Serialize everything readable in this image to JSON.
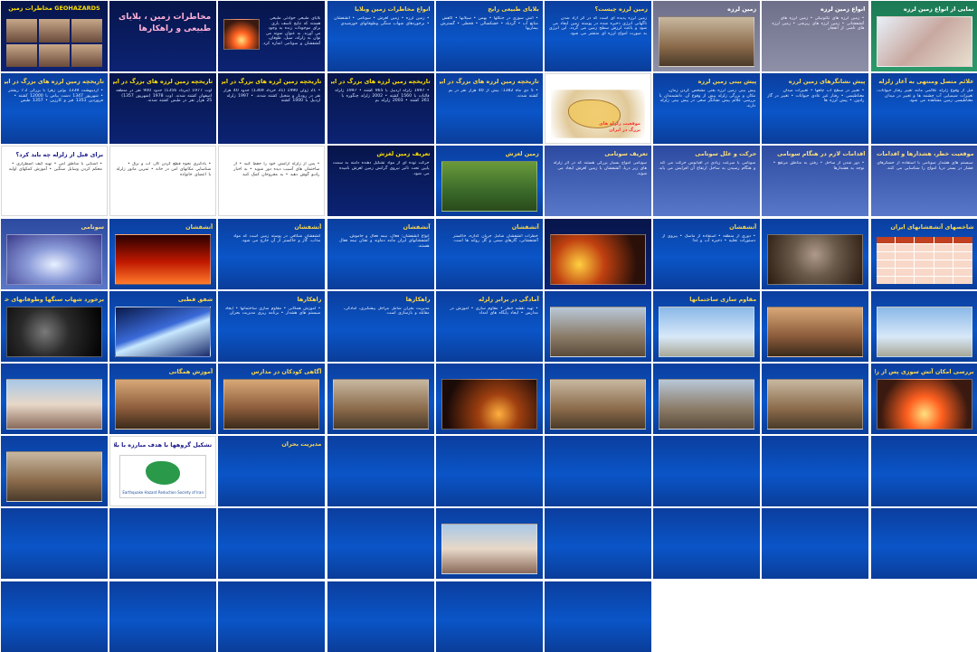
{
  "slides": [
    {
      "title": "مخاطرات زمین GEOHAZARDS",
      "body": "",
      "theme": "navy",
      "pic": "cover"
    },
    {
      "title": "",
      "body": "مخاطرات زمین ، بلایای طبیعی و راهکارها",
      "theme": "navy",
      "pic": "bigtitle"
    },
    {
      "title": "",
      "body": "بلایای طبیعی حوادثی طبیعی هستند که نتایج تاسف باری برای موجودات زنده به وجود می آورند. به عنوان نمونه می توان به زلزله، سیل، طوفان، آتشفشان و سونامی اشاره کرد.",
      "theme": "navy",
      "pic": "fire-small"
    },
    {
      "title": "انواع مخاطرات زمین وبلایا",
      "body": "• زمین لرزه  • زمین لغزش  • سونامی  • آتشفشان  • برخوردهای شهاب سنگی وطوفانهای خورشیدی",
      "theme": "blue",
      "pic": ""
    },
    {
      "title": "بلایای طبیعی رایج",
      "body": "• آتش سوزی در جنگلها  • بهمن  • سیلابها  • کاهش منابع آب  • گردباد  • خشکسالی  • قحطی  • گسترش بیماریها",
      "theme": "blue",
      "pic": ""
    },
    {
      "title": "زمین لرزه چیست؟",
      "body": "زمین لرزه پدیده ای است که در اثر آزاد شدن ناگهانی انرژی ذخیره شده در پوسته زمین ایجاد می شود و باعث لرزش سطح زمین می گردد. این انرژی به صورت امواج لرزه ای منتشر می شود.",
      "theme": "blue",
      "pic": ""
    },
    {
      "title": "زمین لرزه",
      "body": "",
      "theme": "gray",
      "pic": "rubble"
    },
    {
      "title": "انواع زمین لرزه",
      "body": "• زمین لرزه های تکتونیکی  • زمین لرزه های آتشفشانی  • زمین لرزه های ریزشی  • زمین لرزه های ناشی از انفجار",
      "theme": "gray",
      "pic": ""
    },
    {
      "title": "نمایی از انواع زمین لرزه",
      "body": "",
      "theme": "green",
      "pic": "fault"
    },
    {
      "title": "تاریخچه زمین لرزه های بزرگ در ایران",
      "body": "• اردیبهشت 1339 بوئین زهرا با بزرگی 7.2 ریشتر  • شهریور 1347 دشت بیاض با 12000 کشته  • فروردین 1351 قیر و کارزین  • 1357 طبس",
      "theme": "blue",
      "pic": ""
    },
    {
      "title": "تاریخچه زمین لرزه های بزرگ در ایران",
      "body": "اوت 1977 (مرداد 1356) حدود 900 نفر در منطقه اصفهان کشته شدند. اوت 1978 (شهریور 1357) 25 هزار نفر در طبس کشته شدند.",
      "theme": "navy",
      "pic": ""
    },
    {
      "title": "تاریخچه زمین لرزه های بزرگ در ایران",
      "body": "• 21 ژوئن 1990 (31 خرداد 1369) حدود 40 هزار نفر در رودبار و منجیل کشته شدند. • 1997 زلزله اردبیل با 1000 کشته",
      "theme": "navy",
      "pic": ""
    },
    {
      "title": "تاریخچه زمین لرزه های بزرگ در ایران",
      "body": "• 1997 زلزله اردبیل با 965 کشته  • 1997 زلزله قائنات با 1560 کشته  • 2002 زلزله چنگوره با 261 کشته  • 2003 زلزله بم",
      "theme": "navy",
      "pic": ""
    },
    {
      "title": "تاریخچه زمین لرزه های بزرگ در ایران",
      "body": "• 5 دی ماه 1382: بیش از 40 هزار نفر در بم کشته شدند.",
      "theme": "blue",
      "pic": ""
    },
    {
      "title": "",
      "body": "",
      "theme": "white",
      "pic": "map"
    },
    {
      "title": "پیش بینی زمین لرزه",
      "body": "پیش بینی زمین لرزه یعنی مشخص کردن زمان، مکان و بزرگی زلزله پیش از وقوع آن. دانشمندان با بررسی علائم پیش نشانگر سعی در پیش بینی زلزله دارند.",
      "theme": "blue",
      "pic": ""
    },
    {
      "title": "پیش نشانگرهای زمین لرزه",
      "body": "• تغییر در سطح آب چاهها  • تغییرات میدان مغناطیسی  • رفتار غیر عادی حیوانات  • تغییر در گاز رادون  • پیش لرزه ها",
      "theme": "blue",
      "pic": ""
    },
    {
      "title": "علائم متصل ومنتهی به آغاز زلزله",
      "body": "قبل از وقوع زلزله علائمی مانند تغییر رفتار حیوانات، تغییرات شیمیایی آب چشمه ها و تغییر در میدان مغناطیسی زمین مشاهده می شود.",
      "theme": "blue",
      "pic": ""
    },
    {
      "title": "برای قبل از زلزله چه باید کرد؟",
      "body": "• آشنایی با مناطق امن  • تهیه کیف اضطراری  • محکم کردن وسایل سنگین  • آموزش کمکهای اولیه",
      "theme": "white",
      "pic": ""
    },
    {
      "title": "",
      "body": "• یادگیری نحوه قطع کردن گاز، آب و برق  • شناسایی مکانهای امن در خانه  • تمرین مانور زلزله با اعضای خانواده",
      "theme": "white",
      "pic": ""
    },
    {
      "title": "",
      "body": "• پس از زلزله آرامش خود را حفظ کنید  • از ساختمان های آسیب دیده دور شوید  • به اخبار رادیو گوش دهید  • به مجروحان کمک کنید",
      "theme": "white",
      "pic": ""
    },
    {
      "title": "تعریف زمین لغزش",
      "body": "حرکت توده ای از مواد تشکیل دهنده دامنه به سمت پایین تحت تاثیر نیروی گرانش زمین لغزش نامیده می شود.",
      "theme": "navy",
      "pic": ""
    },
    {
      "title": "زمین لغزش",
      "body": "",
      "theme": "blue",
      "pic": "landslide"
    },
    {
      "title": "تعریف سونامی",
      "body": "سونامی امواج بسیار بزرگی هستند که در اثر زلزله های زیر دریا، آتشفشان یا زمین لغزش ایجاد می شوند.",
      "theme": "slate",
      "pic": ""
    },
    {
      "title": "حرکت و علل سونامی",
      "body": "سونامی با سرعت زیادی در اقیانوس حرکت می کند و هنگام رسیدن به ساحل ارتفاع آن افزایش می یابد.",
      "theme": "slate",
      "pic": ""
    },
    {
      "title": "اقدامات لازم در هنگام سونامی",
      "body": "• دور شدن از ساحل  • رفتن به مناطق مرتفع  • توجه به هشدارها",
      "theme": "slate",
      "pic": ""
    },
    {
      "title": "موقعیت خطر، هشدارها و اقدامات",
      "body": "سیستم های هشدار سونامی با استفاده از حسگرهای فشار در بستر دریا امواج را شناسایی می کنند.",
      "theme": "slate",
      "pic": ""
    },
    {
      "title": "سونامی",
      "body": "",
      "theme": "slate",
      "pic": "wave"
    },
    {
      "title": "آتشفشان",
      "body": "",
      "theme": "blue",
      "pic": "lava"
    },
    {
      "title": "آتشفشان",
      "body": "آتشفشان شکافی در پوسته زمین است که مواد مذاب، گاز و خاکستر از آن خارج می شود.",
      "theme": "blue",
      "pic": ""
    },
    {
      "title": "آتشفشان",
      "body": "انواع آتشفشان: فعال، نیمه فعال و خاموش. آتشفشانهای ایران مانند دماوند و تفتان نیمه فعال هستند.",
      "theme": "blue",
      "pic": ""
    },
    {
      "title": "آتشفشان",
      "body": "خطرات آتشفشان شامل جریان گدازه، خاکستر آتشفشانی، گازهای سمی و گل روانه ها است.",
      "theme": "blue",
      "pic": ""
    },
    {
      "title": "",
      "body": "",
      "theme": "navy",
      "pic": "eruption"
    },
    {
      "title": "آتشفشان",
      "body": "• دوری از منطقه  • استفاده از ماسک  • پیروی از دستورات تخلیه  • ذخیره آب و غذا",
      "theme": "blue",
      "pic": ""
    },
    {
      "title": "",
      "body": "",
      "theme": "blue",
      "pic": "ashcloud"
    },
    {
      "title": "شاخصهای آتشفشانهای ایران",
      "body": "",
      "theme": "blue",
      "pic": "table"
    },
    {
      "title": "برخورد شهاب سنگها وطوفانهای خورشیدی",
      "body": "",
      "theme": "blue",
      "pic": "meteor"
    },
    {
      "title": "شفق قطبی",
      "body": "",
      "theme": "blue",
      "pic": "aurora"
    },
    {
      "title": "راهکارها",
      "body": "• آموزش همگانی  • مقاوم سازی ساختمانها  • ایجاد سیستم های هشدار  • برنامه ریزی مدیریت بحران",
      "theme": "blue",
      "pic": ""
    },
    {
      "title": "راهکارها",
      "body": "مدیریت بحران شامل مراحل پیشگیری، آمادگی، مقابله و بازسازی است.",
      "theme": "blue",
      "pic": ""
    },
    {
      "title": "آمادگی در برابر زلزله",
      "body": "• تهیه نقشه خطر  • مقاوم سازی  • آموزش در مدارس  • ایجاد پایگاه های امداد",
      "theme": "blue",
      "pic": ""
    },
    {
      "title": "",
      "body": "",
      "theme": "blue",
      "pic": "city"
    },
    {
      "title": "مقاوم سازی ساختمانها",
      "body": "",
      "theme": "blue",
      "pic": "building"
    },
    {
      "title": "",
      "body": "",
      "theme": "blue",
      "pic": "rescuers"
    },
    {
      "title": "",
      "body": "",
      "theme": "blue",
      "pic": "helicopter"
    },
    {
      "title": "",
      "body": "",
      "theme": "blue",
      "pic": "kids"
    },
    {
      "title": "آموزش همگانی",
      "body": "",
      "theme": "blue",
      "pic": "people"
    },
    {
      "title": "آگاهی کودکان در مدارس",
      "body": "",
      "theme": "blue",
      "pic": "school"
    },
    {
      "title": "",
      "body": "",
      "theme": "blue",
      "pic": "ruins"
    },
    {
      "title": "",
      "body": "",
      "theme": "blue",
      "pic": "nightfire"
    },
    {
      "title": "",
      "body": "",
      "theme": "blue",
      "pic": "crowd"
    },
    {
      "title": "",
      "body": "",
      "theme": "blue",
      "pic": "cityruin"
    },
    {
      "title": "",
      "body": "",
      "theme": "blue",
      "pic": "market"
    },
    {
      "title": "بررسی امکان آتش سوزی پس از زلزله",
      "body": "",
      "theme": "blue",
      "pic": "fire"
    },
    {
      "title": "",
      "body": "",
      "theme": "blue",
      "pic": "rubble2"
    },
    {
      "title": "تشکیل گروهها با هدف مبارزه با بلایا",
      "body": "",
      "theme": "white",
      "pic": "logo"
    },
    {
      "title": "مدیریت بحران",
      "body": "",
      "theme": "blue",
      "pic": ""
    },
    {
      "title": "",
      "body": "",
      "theme": "blue",
      "pic": ""
    },
    {
      "title": "",
      "body": "",
      "theme": "blue",
      "pic": ""
    },
    {
      "title": "",
      "body": "",
      "theme": "blue",
      "pic": ""
    },
    {
      "title": "",
      "body": "",
      "theme": "blue",
      "pic": ""
    },
    {
      "title": "",
      "body": "",
      "theme": "blue",
      "pic": ""
    },
    {
      "title": "",
      "body": "",
      "theme": "blue",
      "pic": ""
    },
    {
      "title": "",
      "body": "",
      "theme": "blue",
      "pic": ""
    },
    {
      "title": "",
      "body": "",
      "theme": "blue",
      "pic": ""
    },
    {
      "title": "",
      "body": "",
      "theme": "blue",
      "pic": ""
    },
    {
      "title": "",
      "body": "",
      "theme": "blue",
      "pic": ""
    },
    {
      "title": "",
      "body": "",
      "theme": "blue",
      "pic": "girl"
    },
    {
      "title": "",
      "body": "",
      "theme": "blue",
      "pic": ""
    },
    {
      "title": "",
      "body": "",
      "theme": "blue",
      "pic": ""
    },
    {
      "title": "",
      "body": "",
      "theme": "blue",
      "pic": ""
    },
    {
      "title": "",
      "body": "",
      "theme": "blue",
      "pic": ""
    },
    {
      "title": "",
      "body": "",
      "theme": "blue",
      "pic": ""
    },
    {
      "title": "",
      "body": "",
      "theme": "blue",
      "pic": ""
    },
    {
      "title": "",
      "body": "",
      "theme": "blue",
      "pic": ""
    },
    {
      "title": "",
      "body": "",
      "theme": "blue",
      "pic": ""
    },
    {
      "title": "",
      "body": "",
      "theme": "blue",
      "pic": ""
    },
    {
      "title": "",
      "body": "",
      "theme": "blue",
      "pic": ""
    }
  ],
  "map": {
    "label_1": "موقعیت زلزله های",
    "label_2": "بزرگ در ایران"
  },
  "cover_label": "GEOHAZARDS",
  "logo_caption": "Earthquake Hazard Reduction Society of Iran",
  "icons": {
    "bullet": "bullet-icon",
    "star": "star-icon"
  }
}
